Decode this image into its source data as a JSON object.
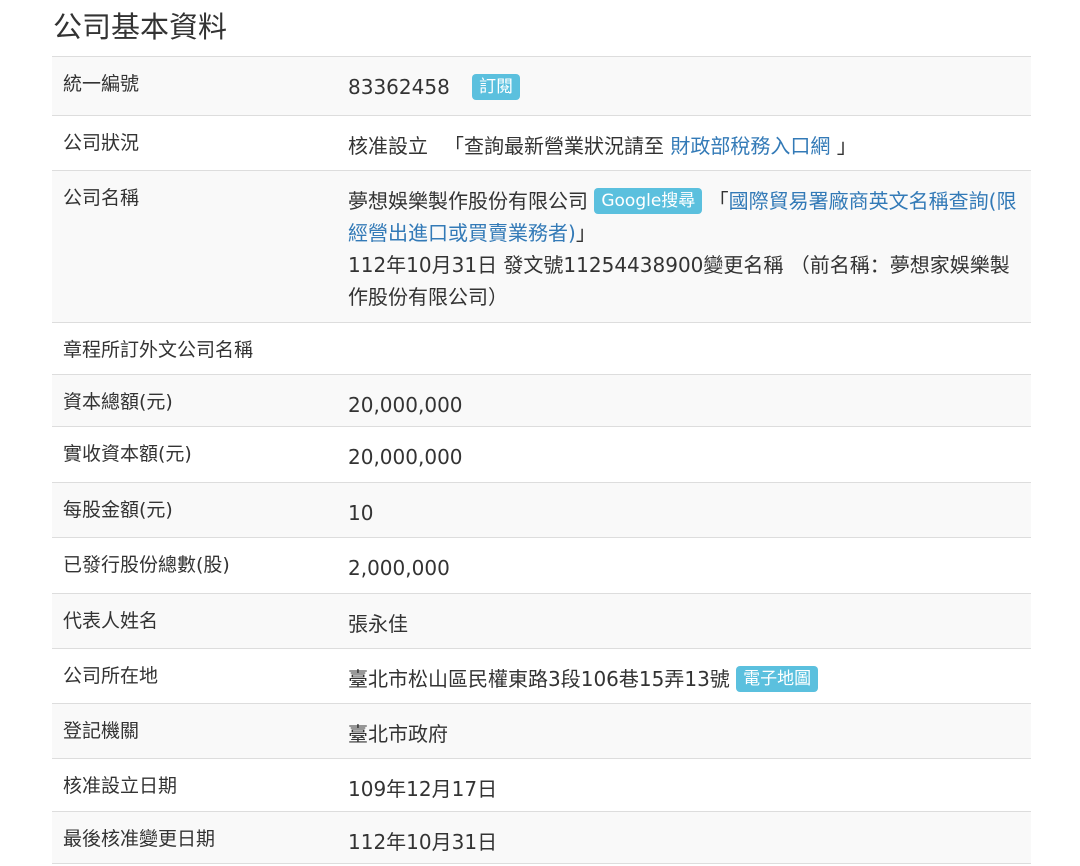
{
  "page_title": "公司基本資料",
  "rows": {
    "uniform_number": {
      "label": "統一編號",
      "value": "83362458",
      "badge": "訂閱"
    },
    "status": {
      "label": "公司狀況",
      "value": "核准設立",
      "prefix": "「查詢最新營業狀況請至",
      "link": "財政部稅務入口網",
      "suffix": "」"
    },
    "name": {
      "label": "公司名稱",
      "value": "夢想娛樂製作股份有限公司",
      "badge": "Google搜尋",
      "bracket_open": "「",
      "link": "國際貿易署廠商英文名稱查詢(限經營出進口或買賣業務者)",
      "bracket_close": "」",
      "change_note": "112年10月31日 發文號11254438900變更名稱 （前名稱：夢想家娛樂製作股份有限公司）"
    },
    "foreign_name": {
      "label": "章程所訂外文公司名稱",
      "value": ""
    },
    "capital_total": {
      "label": "資本總額(元)",
      "value": "20,000,000"
    },
    "capital_paid": {
      "label": "實收資本額(元)",
      "value": "20,000,000"
    },
    "par_value": {
      "label": "每股金額(元)",
      "value": "10"
    },
    "shares_issued": {
      "label": "已發行股份總數(股)",
      "value": "2,000,000"
    },
    "representative": {
      "label": "代表人姓名",
      "value": "張永佳"
    },
    "address": {
      "label": "公司所在地",
      "value": "臺北市松山區民權東路3段106巷15弄13號",
      "badge": "電子地圖"
    },
    "registrar": {
      "label": "登記機關",
      "value": "臺北市政府"
    },
    "approval_date": {
      "label": "核准設立日期",
      "value": "109年12月17日"
    },
    "last_change_date": {
      "label": "最後核准變更日期",
      "value": "112年10月31日"
    }
  },
  "colors": {
    "badge": "#5bc0de",
    "link": "#337ab7",
    "stripe": "#f9f9f9",
    "border": "#dddddd"
  }
}
